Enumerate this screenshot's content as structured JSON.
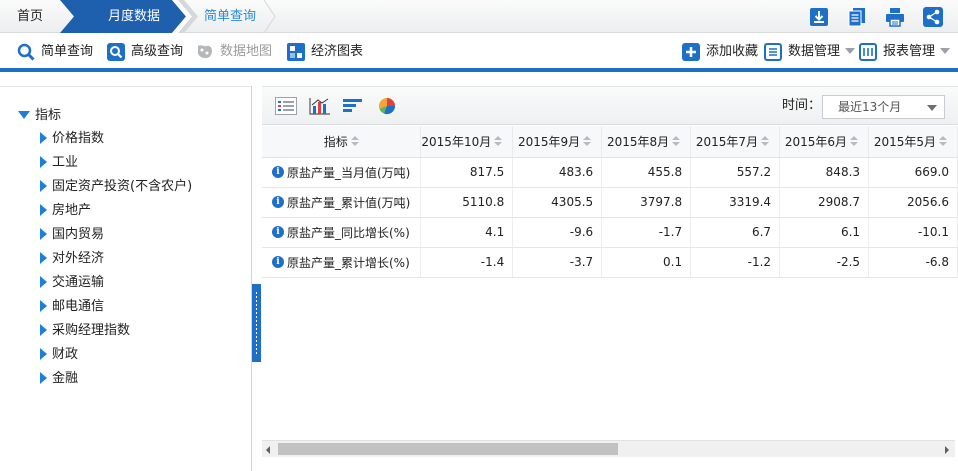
{
  "breadcrumb": {
    "home": "首页",
    "month": "月度数据",
    "query": "简单查询"
  },
  "header_icons": [
    "download-icon",
    "copy-icon",
    "print-icon",
    "share-icon"
  ],
  "toolbar": {
    "simple_query": "简单查询",
    "advanced_query": "高级查询",
    "data_map": "数据地图",
    "economic_chart": "经济图表",
    "add_favorite": "添加收藏",
    "data_manage": "数据管理",
    "report_manage": "报表管理"
  },
  "tree": {
    "root": "指标",
    "items": [
      "价格指数",
      "工业",
      "固定资产投资(不含农户)",
      "房地产",
      "国内贸易",
      "对外经济",
      "交通运输",
      "邮电通信",
      "采购经理指数",
      "财政",
      "金融"
    ]
  },
  "viewbar": {
    "icons": [
      "table-view-icon",
      "bar-chart-icon",
      "horizontal-bar-icon",
      "pie-chart-icon"
    ],
    "time_label": "时间：",
    "time_value": "最近13个月"
  },
  "table": {
    "headers": [
      "指标",
      "2015年10月",
      "2015年9月",
      "2015年8月",
      "2015年7月",
      "2015年6月",
      "2015年5月"
    ],
    "rows": [
      {
        "name": "原盐产量_当月值(万吨)",
        "values": [
          "817.5",
          "483.6",
          "455.8",
          "557.2",
          "848.3",
          "669.0"
        ]
      },
      {
        "name": "原盐产量_累计值(万吨)",
        "values": [
          "5110.8",
          "4305.5",
          "3797.8",
          "3319.4",
          "2908.7",
          "2056.6"
        ]
      },
      {
        "name": "原盐产量_同比增长(%)",
        "values": [
          "4.1",
          "-9.6",
          "-1.7",
          "6.7",
          "6.1",
          "-10.1"
        ]
      },
      {
        "name": "原盐产量_累计增长(%)",
        "values": [
          "-1.4",
          "-3.7",
          "0.1",
          "-1.2",
          "-2.5",
          "-6.8"
        ]
      }
    ]
  },
  "colors": {
    "accent": "#1e6fc8",
    "link": "#2a8ad8"
  }
}
